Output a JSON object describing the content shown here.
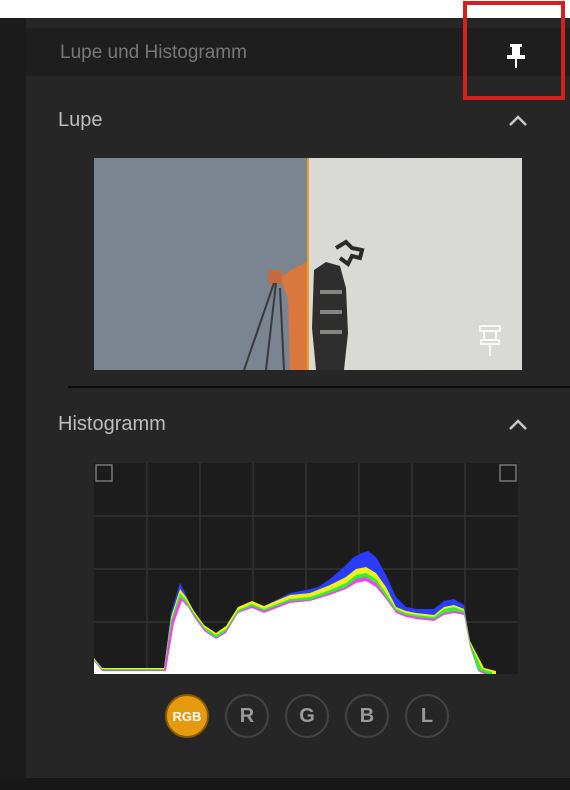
{
  "header": {
    "title": "Lupe und Histogramm"
  },
  "loupe": {
    "title": "Lupe"
  },
  "histogram": {
    "title": "Histogramm"
  },
  "channels": {
    "rgb": "RGB",
    "r": "R",
    "g": "G",
    "b": "B",
    "l": "L"
  },
  "colors": {
    "accent": "#e69a10",
    "highlight_box": "#d42020",
    "panel_bg": "#262626"
  },
  "icons": {
    "header_pin": "pin-icon",
    "loupe_pin": "pin-outline-icon",
    "collapse": "chevron-up-icon"
  }
}
